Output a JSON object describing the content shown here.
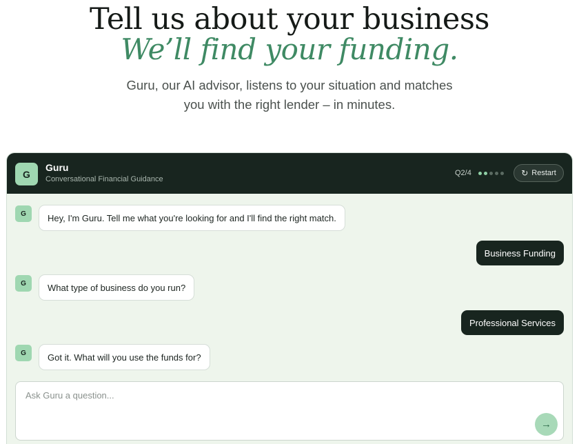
{
  "hero": {
    "title": "Tell us about your business",
    "subtitle": "We’ll find your funding.",
    "description": "Guru, our AI advisor, listens to your situation and matches you with the right lender – in minutes."
  },
  "chat": {
    "header": {
      "avatar_letter": "G",
      "name": "Guru",
      "tagline": "Conversational Financial Guidance",
      "progress": "Q2/4",
      "steps_total": 5,
      "steps_active": 2,
      "restart_label": "Restart",
      "restart_icon": "refresh-icon"
    },
    "messages": [
      {
        "from": "bot",
        "avatar": "G",
        "text": "Hey, I'm Guru. Tell me what you're looking for and I'll find the right match."
      },
      {
        "from": "user",
        "text": "Business Funding"
      },
      {
        "from": "bot",
        "avatar": "G",
        "text": "What type of business do you run?"
      },
      {
        "from": "user",
        "text": "Professional Services"
      },
      {
        "from": "bot",
        "avatar": "G",
        "text": "Got it. What will you use the funds for?"
      }
    ],
    "composer": {
      "placeholder": "Ask Guru a question...",
      "value": "",
      "send_icon": "arrow-right-icon"
    }
  },
  "colors": {
    "accent_green": "#3f8a64",
    "header_bg": "#18251f",
    "chat_bg": "#eef5ec",
    "avatar_bg": "#9fd7b1"
  }
}
